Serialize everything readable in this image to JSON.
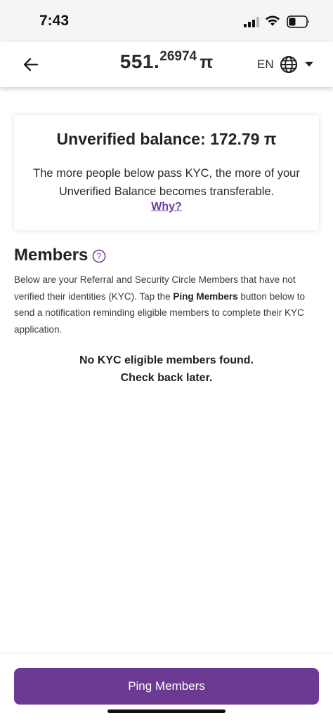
{
  "status_bar": {
    "time": "7:43",
    "icons": [
      "cellular-signal-icon",
      "wifi-icon",
      "battery-icon"
    ]
  },
  "header": {
    "back_icon": "arrow-left-icon",
    "balance_int": "551.",
    "balance_dec": "26974",
    "pi_symbol": "π",
    "lang_code": "EN",
    "globe_icon": "globe-icon",
    "caret_icon": "caret-down-icon"
  },
  "card": {
    "title": "Unverified balance: 172.79 π",
    "description": "The more people below pass KYC, the more of your Unverified Balance becomes transferable.",
    "link": "Why?"
  },
  "members": {
    "title": "Members",
    "help_icon": "question-circle-icon",
    "desc_part1": "Below are your Referral and Security Circle Members that have not verified their identities (KYC). Tap the ",
    "desc_bold": "Ping Members",
    "desc_part2": " button below to send a notification reminding eligible members to complete their KYC application.",
    "empty_line1": "No KYC eligible members found.",
    "empty_line2": "Check back later."
  },
  "footer": {
    "ping_button": "Ping Members"
  },
  "colors": {
    "accent": "#6d3a93",
    "link": "#6b3fa0"
  }
}
